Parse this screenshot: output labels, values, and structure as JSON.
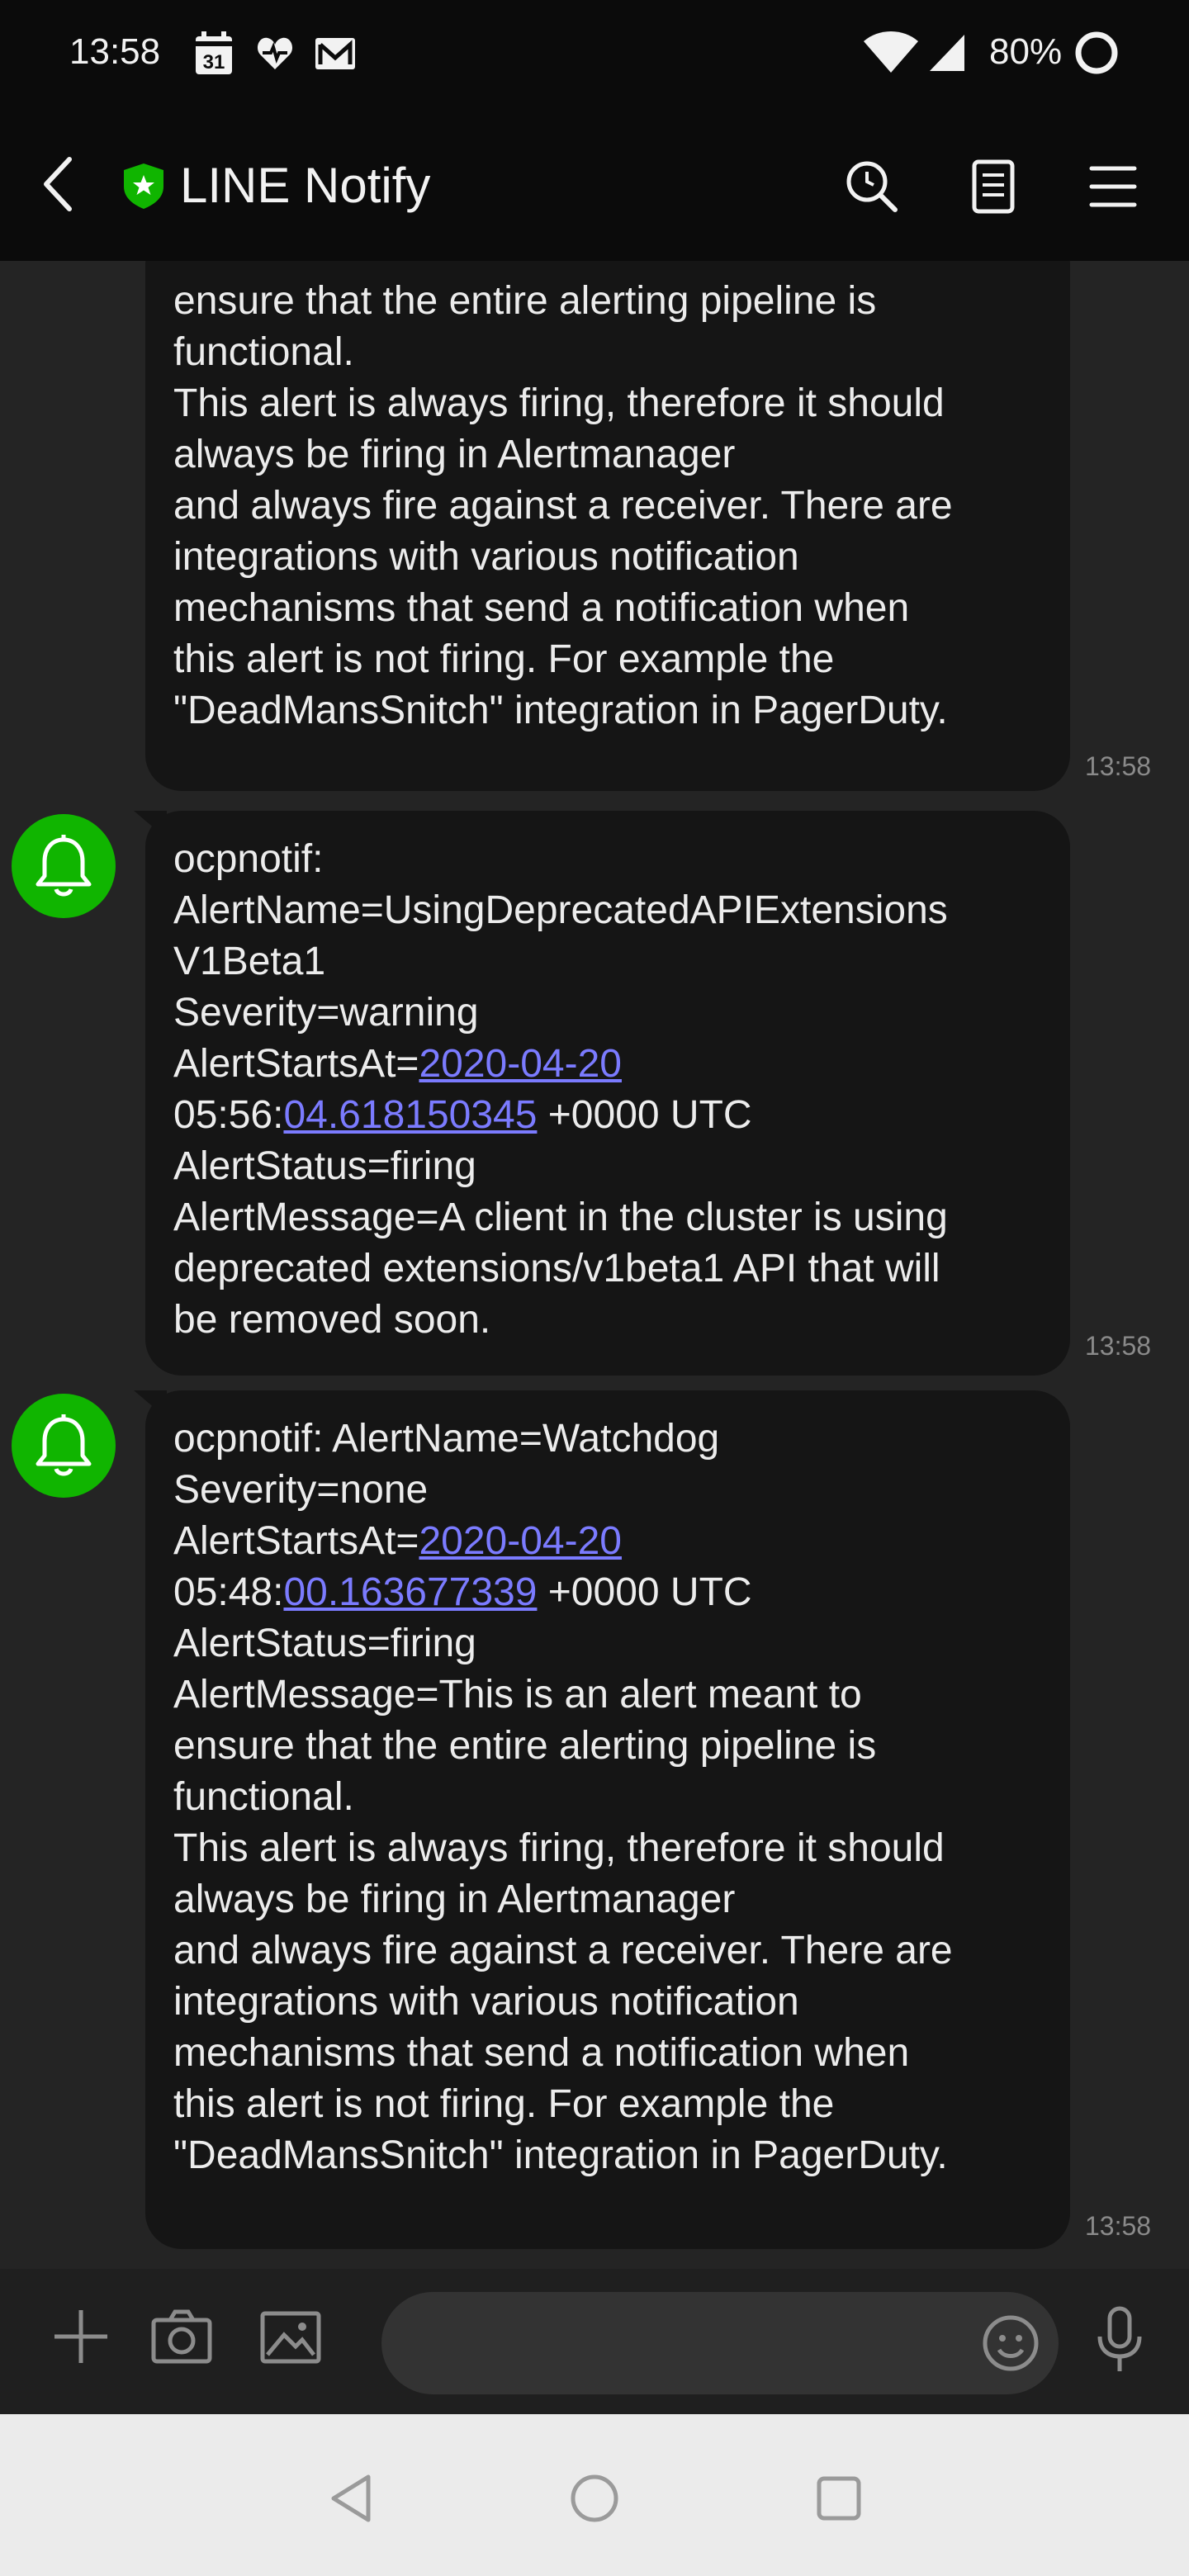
{
  "status_bar": {
    "time": "13:58",
    "calendar_day": "31",
    "battery": "80%",
    "icons": [
      "calendar-icon",
      "health-icon",
      "mail-icon",
      "wifi-icon",
      "signal-icon",
      "battery-icon"
    ]
  },
  "header": {
    "title": "LINE Notify",
    "icons": [
      "back-icon",
      "shield-icon",
      "search-icon",
      "notes-icon",
      "menu-icon"
    ]
  },
  "messages": [
    {
      "segments": [
        {
          "text": "ensure that the entire alerting pipeline is\nfunctional.\nThis alert is always firing, therefore it should\nalways be firing in Alertmanager\nand always fire against a receiver. There are\nintegrations with various notification\nmechanisms that send a notification when\nthis alert is not firing. For example the\n\"DeadMansSnitch\" integration in PagerDuty."
        }
      ],
      "time": "13:58"
    },
    {
      "segments": [
        {
          "text": "ocpnotif:\nAlertName=UsingDeprecatedAPIExtensions\nV1Beta1\nSeverity=warning\nAlertStartsAt="
        },
        {
          "text": "2020-04-20",
          "link": true
        },
        {
          "text": "\n05:56:"
        },
        {
          "text": "04.618150345",
          "link": true
        },
        {
          "text": " +0000 UTC\nAlertStatus=firing\nAlertMessage=A client in the cluster is using\ndeprecated extensions/v1beta1 API that will\nbe removed soon."
        }
      ],
      "time": "13:58"
    },
    {
      "segments": [
        {
          "text": "ocpnotif: AlertName=Watchdog\nSeverity=none\nAlertStartsAt="
        },
        {
          "text": "2020-04-20",
          "link": true
        },
        {
          "text": "\n05:48:"
        },
        {
          "text": "00.163677339",
          "link": true
        },
        {
          "text": " +0000 UTC\nAlertStatus=firing\nAlertMessage=This is an alert meant to\nensure that the entire alerting pipeline is\nfunctional.\nThis alert is always firing, therefore it should\nalways be firing in Alertmanager\nand always fire against a receiver. There are\nintegrations with various notification\nmechanisms that send a notification when\nthis alert is not firing. For example the\n\"DeadMansSnitch\" integration in PagerDuty."
        }
      ],
      "time": "13:58"
    }
  ],
  "input_bar": {
    "icons": [
      "plus-icon",
      "camera-icon",
      "image-icon",
      "emoji-icon",
      "microphone-icon"
    ]
  },
  "nav_bar": {
    "icons": [
      "nav-back-icon",
      "nav-home-icon",
      "nav-recents-icon"
    ]
  },
  "colors": {
    "accent_green": "#10b500",
    "link": "#7b7bff",
    "bubble": "#151515",
    "background": "#242424"
  }
}
